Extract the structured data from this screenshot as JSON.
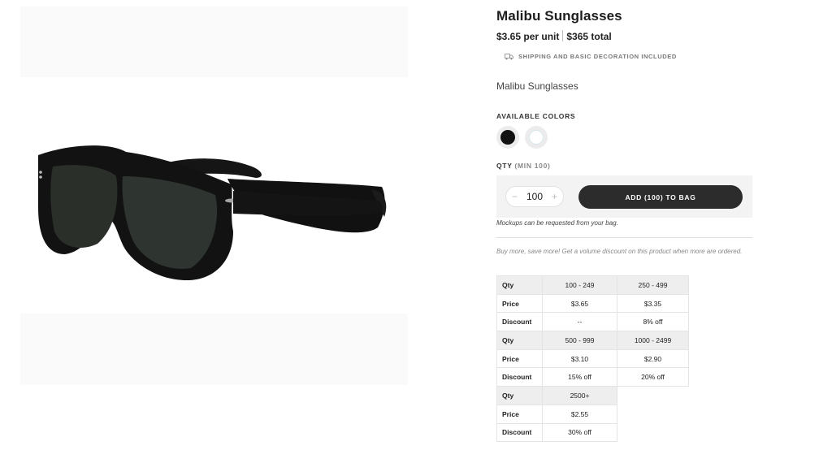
{
  "product": {
    "title": "Malibu Sunglasses",
    "unit_price": "$3.65 per unit",
    "total_price": "$365 total",
    "shipping_note": "SHIPPING AND BASIC DECORATION INCLUDED",
    "description": "Malibu Sunglasses"
  },
  "colors": {
    "label": "AVAILABLE COLORS",
    "options": [
      {
        "name": "black",
        "hex": "#111111"
      },
      {
        "name": "white",
        "hex": "#ffffff"
      }
    ]
  },
  "quantity": {
    "label": "QTY",
    "min_note": "(MIN 100)",
    "value": "100",
    "minus": "−",
    "plus": "+"
  },
  "cart": {
    "add_label": "ADD (100) TO BAG",
    "mockups_note": "Mockups can be requested from your bag."
  },
  "promo": "Buy more, save more! Get a volume discount on this product when more are ordered.",
  "pricing_tiers": {
    "labels": {
      "qty": "Qty",
      "price": "Price",
      "discount": "Discount"
    },
    "tiers": [
      {
        "qty": "100 - 249",
        "price": "$3.65",
        "discount": "--"
      },
      {
        "qty": "250 - 499",
        "price": "$3.35",
        "discount": "8% off"
      },
      {
        "qty": "500 - 999",
        "price": "$3.10",
        "discount": "15% off"
      },
      {
        "qty": "1000 - 2499",
        "price": "$2.90",
        "discount": "20% off"
      },
      {
        "qty": "2500+",
        "price": "$2.55",
        "discount": "30% off"
      }
    ]
  },
  "colors_theme": {
    "accent": "#2c2c2c",
    "panel": "#f3f3f3"
  }
}
